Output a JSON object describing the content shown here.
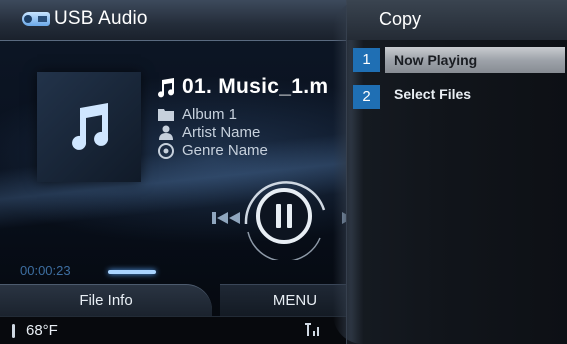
{
  "header": {
    "title": "USB Audio",
    "source_icon": "usb-icon"
  },
  "track": {
    "title": "01. Music_1.m",
    "album": "Album 1",
    "artist": "Artist Name",
    "genre": "Genre Name"
  },
  "playback": {
    "elapsed": "00:00:23",
    "state": "playing"
  },
  "bottom_tabs": {
    "file_info": "File Info",
    "menu": "MENU"
  },
  "status": {
    "temperature": "68°F"
  },
  "popup_menu": {
    "title": "Copy",
    "items": [
      {
        "label": "Now Playing",
        "selected": true
      },
      {
        "label": "Select Files",
        "selected": false
      }
    ]
  },
  "callouts": [
    "1",
    "2"
  ],
  "colors": {
    "accent": "#1f6fb4",
    "selection": "#b4b8be",
    "progress": "#a9d4ff"
  }
}
